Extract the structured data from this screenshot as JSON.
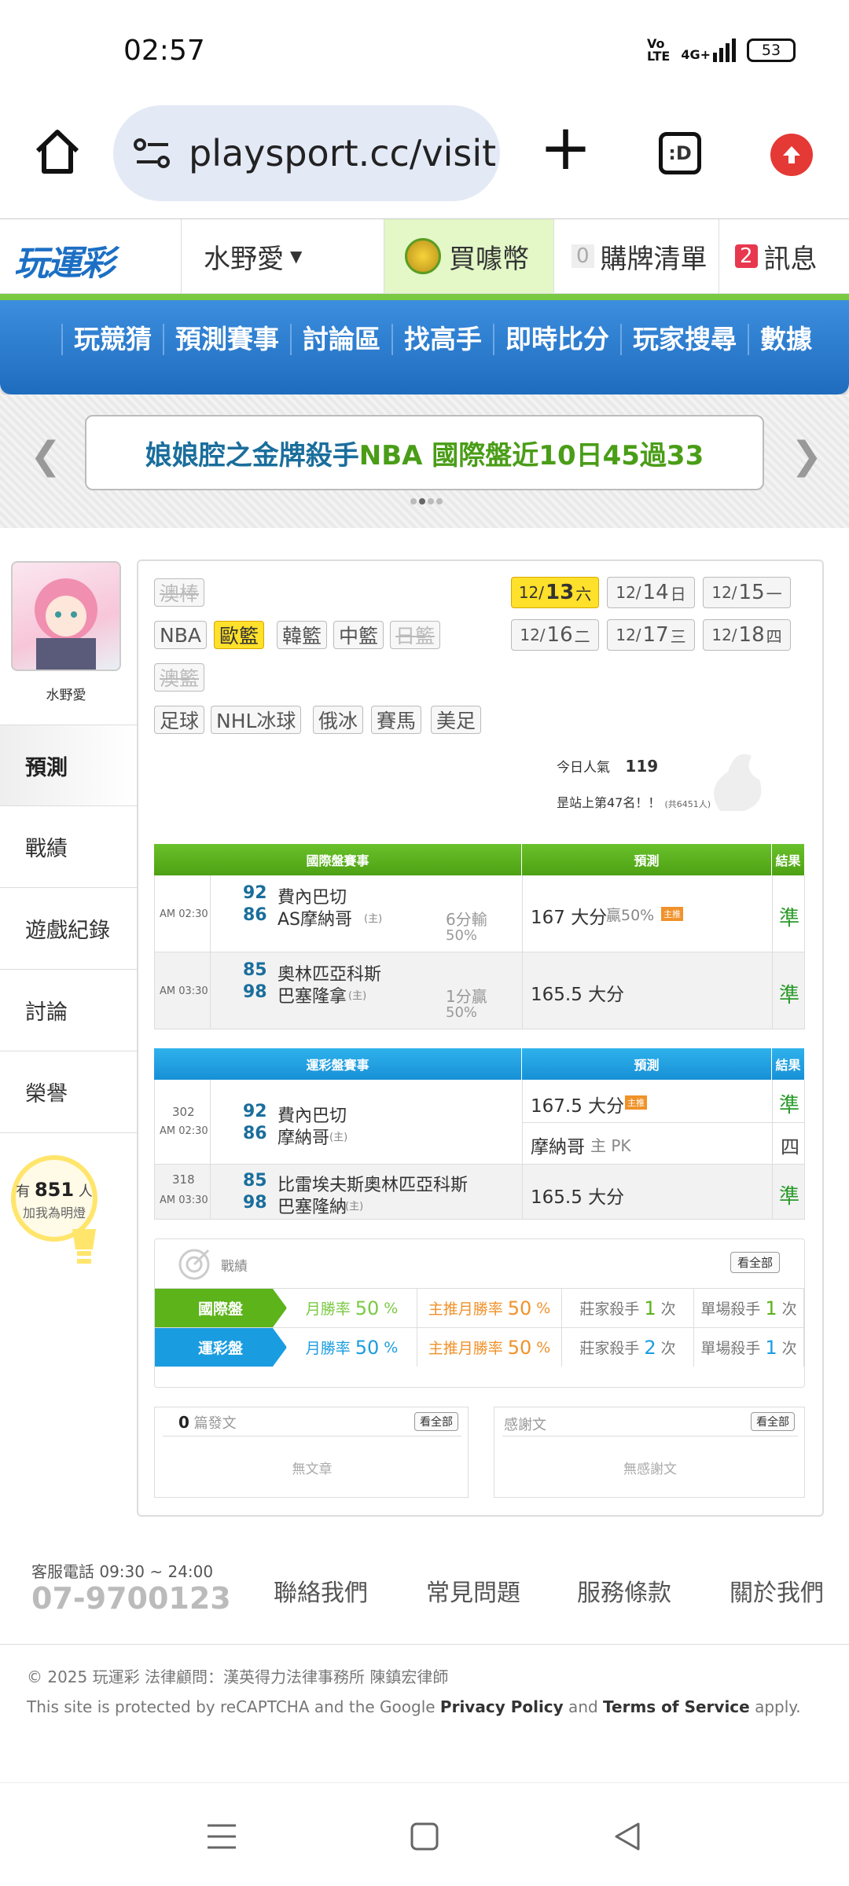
{
  "status": {
    "time": "02:57",
    "network": "4G+",
    "battery": "53"
  },
  "browser": {
    "url": "playsport.cc/visit",
    "home": "home-icon",
    "newtab": "+",
    "tabs": ":D"
  },
  "site": {
    "logo": "玩運彩",
    "user_menu": "水野愛",
    "buy": "買噱幣",
    "cart_count": "0",
    "cart_label": "購牌清單",
    "msg_count": "2",
    "msg_label": "訊息"
  },
  "nav": [
    "玩競猜",
    "預測賽事",
    "討論區",
    "找高手",
    "即時比分",
    "玩家搜尋",
    "數據"
  ],
  "banner": {
    "text1": "娘娘腔之金牌殺手 ",
    "text2": "NBA 國際盤近10日45過33"
  },
  "profile": {
    "name": "水野愛",
    "bulb_pre": "有",
    "bulb_count": "851",
    "bulb_post": "人",
    "bulb_sub": "加我為明燈"
  },
  "sidebar": [
    "預測",
    "戰績",
    "遊戲紀錄",
    "討論",
    "榮譽"
  ],
  "sports": [
    "澳棒",
    "NBA",
    "歐籃",
    "韓籃",
    "中籃",
    "日籃",
    "澳籃",
    "足球",
    "NHL冰球",
    "俄冰",
    "賽馬",
    "美足"
  ],
  "dates": [
    {
      "m": "12/",
      "d": "13",
      "w": "六"
    },
    {
      "m": "12/",
      "d": "14",
      "w": "日"
    },
    {
      "m": "12/",
      "d": "15",
      "w": "一"
    },
    {
      "m": "12/",
      "d": "16",
      "w": "二"
    },
    {
      "m": "12/",
      "d": "17",
      "w": "三"
    },
    {
      "m": "12/",
      "d": "18",
      "w": "四"
    }
  ],
  "popularity": {
    "label": "今日人氣",
    "value": "119",
    "rank": "昰站上第47名！！",
    "rank_small": "(共6451人)"
  },
  "intl_table": {
    "headers": [
      "國際盤賽事",
      "預測",
      "結果"
    ],
    "rows": [
      {
        "time": "AM 02:30",
        "s1": "92",
        "t1": "費內巴切",
        "s2": "86",
        "t2": "AS摩納哥",
        "home": "(主)",
        "diff1": "6分輸",
        "diff2": "50%",
        "pred": "167 大分",
        "extra": "贏50%",
        "badge": "主推",
        "result": "準"
      },
      {
        "time": "AM 03:30",
        "s1": "85",
        "t1": "奧林匹亞科斯",
        "s2": "98",
        "t2": "巴塞隆拿",
        "home": "(主)",
        "diff1": "1分贏",
        "diff2": "50%",
        "pred": "165.5 大分",
        "extra": "",
        "badge": "",
        "result": "準"
      }
    ]
  },
  "lottery_table": {
    "headers": [
      "運彩盤賽事",
      "預測",
      "結果"
    ],
    "rows": [
      {
        "no": "302",
        "time": "AM 02:30",
        "s1": "92",
        "t1": "費內巴切",
        "s2": "86",
        "t2": "摩納哥",
        "home": "(主)",
        "pred1": "167.5 大分",
        "badge": "主推",
        "r1": "準",
        "pred2": "摩納哥",
        "pred2_sub": "主 PK",
        "r2": "四"
      },
      {
        "no": "318",
        "time": "AM 03:30",
        "s1": "85",
        "t1": "比雷埃夫斯奧林匹亞科斯",
        "s2": "98",
        "t2": "巴塞隆納",
        "home": "(主)",
        "pred1": "165.5 大分",
        "r1": "準"
      }
    ]
  },
  "record": {
    "title": "戰績",
    "viewall": "看全部",
    "rows": [
      {
        "label": "國際盤",
        "c1l": "月勝率",
        "c1v": "50",
        "c2l": "主推月勝率",
        "c2v": "50",
        "c3l": "莊家殺手",
        "c3v": "1",
        "c4l": "單場殺手",
        "c4v": "1",
        "unit": "%",
        "times": "次"
      },
      {
        "label": "運彩盤",
        "c1l": "月勝率",
        "c1v": "50",
        "c2l": "主推月勝率",
        "c2v": "50",
        "c3l": "莊家殺手",
        "c3v": "2",
        "c4l": "單場殺手",
        "c4v": "1",
        "unit": "%",
        "times": "次"
      }
    ]
  },
  "posts": {
    "count": "0",
    "label": "篇發文",
    "viewall": "看全部",
    "empty": "無文章"
  },
  "thanks": {
    "label": "感謝文",
    "viewall": "看全部",
    "empty": "無感謝文"
  },
  "footer": {
    "phone_label": "客服電話 09:30 ~ 24:00",
    "phone": "07-9700123",
    "links": [
      "聯絡我們",
      "常見問題",
      "服務條款",
      "關於我們"
    ],
    "copyright": "© 2025 玩運彩 法律顧問：漢英得力法律事務所 陳鎮宏律師",
    "recaptcha_pre": "This site is protected by reCAPTCHA and the Google ",
    "privacy": "Privacy Policy",
    "and": " and ",
    "terms": "Terms of Service",
    "apply": " apply."
  },
  "colors": {
    "green": "#5cb31a",
    "blue": "#1a9de0",
    "yellow": "#ffe02a",
    "nav_blue": "#2a7bd0"
  }
}
